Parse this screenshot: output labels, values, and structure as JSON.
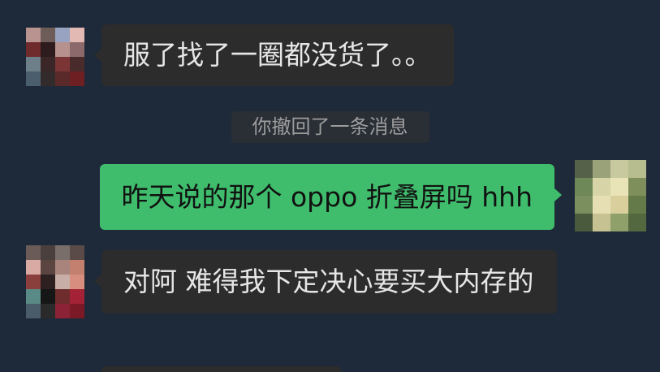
{
  "colors": {
    "background": "#1e2939",
    "bubble_incoming": "#2c2c2c",
    "bubble_outgoing": "#3fbd6c",
    "text_incoming": "#e6e6e6",
    "text_outgoing": "#111111",
    "system_background": "#2a2e35",
    "system_text": "#9d9d9d"
  },
  "chat": {
    "message_1": {
      "text": "服了找了一圈都没货了。。"
    },
    "recall_notice": {
      "text": "你撤回了一条消息"
    },
    "message_2": {
      "text": "昨天说的那个 oppo 折叠屏吗 hhh"
    },
    "message_3": {
      "text": "对阿 难得我下定决心要买大内存的"
    }
  },
  "avatars": {
    "contact_1": {
      "mosaic": [
        [
          "#b8938f",
          "#6e5c58",
          "#97a3c0",
          "#e3b9b3"
        ],
        [
          "#6f2a2c",
          "#2d1b1d",
          "#b7918e",
          "#8c6a6b"
        ],
        [
          "#6d7f88",
          "#3a2626",
          "#7b3535",
          "#4a2b2b"
        ],
        [
          "#4b5e6d",
          "#332a2c",
          "#5a2a2b",
          "#6e1f22"
        ]
      ]
    },
    "me": {
      "mosaic": [
        [
          "#56614a",
          "#9aa27a",
          "#c9c9a0",
          "#b7bd8f"
        ],
        [
          "#6f8858",
          "#d7d5a8",
          "#e9e3b8",
          "#7f8f5c"
        ],
        [
          "#7a8e5e",
          "#e6dfb4",
          "#d8cf9c",
          "#647a48"
        ],
        [
          "#4a5a3c",
          "#c7c292",
          "#8fa06a",
          "#53683f"
        ]
      ]
    },
    "contact_2": {
      "mosaic": [
        [
          "#6a5a58",
          "#4a3f3d",
          "#7a6e6a",
          "#5a4a48"
        ],
        [
          "#d9a9a3",
          "#5a4540",
          "#a8847c",
          "#c4806f"
        ],
        [
          "#8a3f3c",
          "#2c2020",
          "#c7aea6",
          "#d78e7e"
        ],
        [
          "#5a8a86",
          "#161616",
          "#6e2c2c",
          "#a32236"
        ],
        [
          "#4a5c6a",
          "#2a2a2a",
          "#8b2236",
          "#7b1a26"
        ]
      ]
    }
  }
}
